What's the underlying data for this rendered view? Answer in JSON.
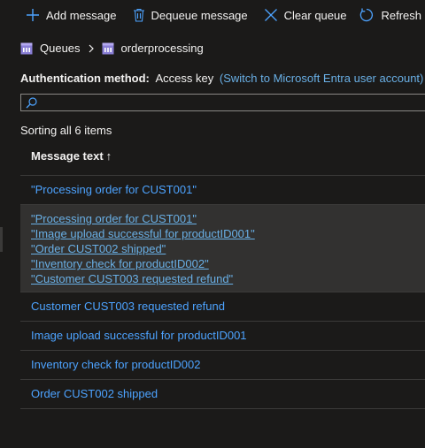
{
  "toolbar": {
    "add_label": "Add message",
    "dequeue_label": "Dequeue message",
    "clear_label": "Clear queue",
    "refresh_label": "Refresh"
  },
  "breadcrumb": {
    "queues": "Queues",
    "current": "orderprocessing"
  },
  "auth": {
    "label": "Authentication method:",
    "value": "Access key",
    "switch_link": "(Switch to Microsoft Entra user account)"
  },
  "search": {
    "placeholder": ""
  },
  "sorting_text": "Sorting all 6 items",
  "table": {
    "column_header": "Message text",
    "sort_arrow": "↑",
    "rows": [
      "\"Processing order for CUST001\"",
      "Customer CUST003 requested refund",
      "Image upload successful for productID001",
      "Inventory check for productID002",
      "Order CUST002 shipped"
    ],
    "selected_lines": [
      "\"Processing order for CUST001\"",
      "\"Image upload successful for productID001\"",
      "\"Order CUST002 shipped\"",
      "\"Inventory check for productID002\"",
      "\"Customer CUST003 requested refund\""
    ]
  },
  "colors": {
    "accent": "#4da3ff",
    "link": "#69afe5",
    "queue_icon": "#8a7fd6"
  },
  "icons": [
    "add-icon",
    "trash-icon",
    "close-icon",
    "refresh-icon",
    "queue-icon",
    "chevron-right-icon",
    "search-icon"
  ]
}
